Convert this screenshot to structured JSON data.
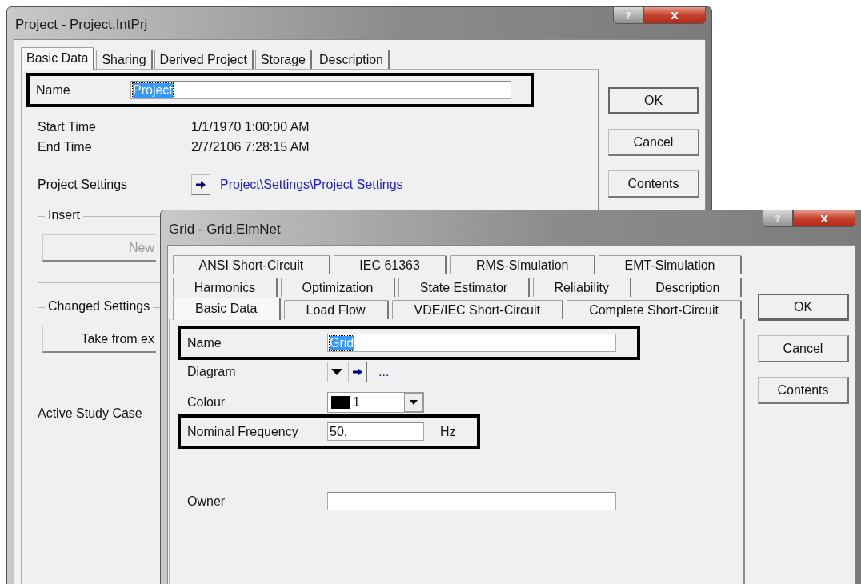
{
  "project_window": {
    "title": "Project - Project.IntPrj",
    "help": "?",
    "close": "X",
    "tabs": [
      {
        "label": "Basic Data",
        "selected": true
      },
      {
        "label": "Sharing",
        "selected": false
      },
      {
        "label": "Derived Project",
        "selected": false
      },
      {
        "label": "Storage",
        "selected": false
      },
      {
        "label": "Description",
        "selected": false
      }
    ],
    "name": {
      "label": "Name",
      "value": "Project",
      "value_selected": true,
      "annotated": true
    },
    "times": [
      {
        "label": "Start Time",
        "value": "1/1/1970 1:00:00 AM"
      },
      {
        "label": "End Time",
        "value": "2/7/2106 7:28:15 AM"
      }
    ],
    "project_settings": {
      "label": "Project Settings",
      "link": "Project\\Settings\\Project Settings"
    },
    "groups": [
      {
        "title": "Insert",
        "button": "New",
        "disabled": true
      },
      {
        "title": "Changed Settings",
        "button": "Take from ex",
        "disabled": false
      }
    ],
    "active_study_case": "Active Study Case",
    "buttons": [
      "OK",
      "Cancel",
      "Contents"
    ]
  },
  "grid_window": {
    "title": "Grid - Grid.ElmNet",
    "help": "?",
    "close": "X",
    "tab_rows": [
      [
        {
          "label": "ANSI Short-Circuit",
          "selected": false
        },
        {
          "label": "IEC 61363",
          "selected": false
        },
        {
          "label": "RMS-Simulation",
          "selected": false
        },
        {
          "label": "EMT-Simulation",
          "selected": false
        }
      ],
      [
        {
          "label": "Harmonics",
          "selected": false
        },
        {
          "label": "Optimization",
          "selected": false
        },
        {
          "label": "State Estimator",
          "selected": false
        },
        {
          "label": "Reliability",
          "selected": false
        },
        {
          "label": "Description",
          "selected": false
        }
      ],
      [
        {
          "label": "Basic Data",
          "selected": true
        },
        {
          "label": "Load Flow",
          "selected": false
        },
        {
          "label": "VDE/IEC Short-Circuit",
          "selected": false
        },
        {
          "label": "Complete Short-Circuit",
          "selected": false
        }
      ]
    ],
    "fields": [
      {
        "kind": "text",
        "label": "Name",
        "value": "Grid",
        "value_selected": true,
        "annotated": true
      },
      {
        "kind": "diagram",
        "label": "Diagram",
        "link": "...",
        "annotated": false
      },
      {
        "kind": "colour",
        "label": "Colour",
        "value": "1",
        "color": "#000000",
        "annotated": false
      },
      {
        "kind": "number",
        "label": "Nominal Frequency",
        "value": "50.",
        "unit": "Hz",
        "annotated": true
      },
      {
        "kind": "spacer"
      },
      {
        "kind": "text",
        "label": "Owner",
        "annotated": false
      }
    ],
    "buttons": [
      "OK",
      "Cancel",
      "Contents"
    ]
  }
}
